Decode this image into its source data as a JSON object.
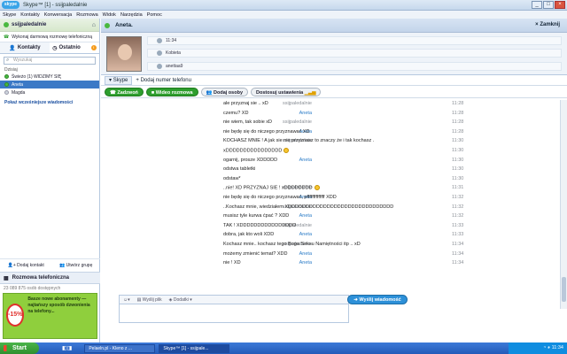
{
  "window": {
    "logo": "skype",
    "title": "Skype™ [1] - ssijpaledalnie"
  },
  "menu": [
    "Skype",
    "Kontakty",
    "Konwersacja",
    "Rozmowa",
    "Widok",
    "Narzędzia",
    "Pomoc"
  ],
  "sidebar": {
    "user": "ssijpaledalnie",
    "free_call": "Wykonaj darmową rozmowę telefoniczną",
    "tabs": [
      "Kontakty",
      "Ostatnio"
    ],
    "search_placeholder": "Wyszukaj",
    "group": "Dzisiaj",
    "contacts": [
      {
        "name": "Świeżo (1) WIDZIMY SIĘ",
        "status": "online"
      },
      {
        "name": "Aneta",
        "status": "online",
        "selected": true
      },
      {
        "name": "Magda",
        "status": "offline"
      }
    ],
    "pending": "Pokaż wcześniejsze wiadomości",
    "add_contact": "Dodaj kontakt",
    "create_group": "Utwórz grupę",
    "phone_call": "Rozmowa telefoniczna",
    "online_count": "23 089 875 osób dostępnych",
    "ad": {
      "badge": "-15%",
      "text": "Basze nowe abonamenty — najtańszy sposób dzwonienia na telefony..."
    }
  },
  "chat": {
    "contact": "Aneta.",
    "close": "Zamknij",
    "profile": {
      "time": "11:34",
      "gender": "Kobieta",
      "login": "anettaa9"
    },
    "tab": "Skype",
    "add_number": "Dodaj numer telefonu",
    "buttons": {
      "call": "Zadzwoń",
      "video": "Wideo rozmowa",
      "add_people": "Dodaj osoby",
      "settings": "Dostosuj ustawienia"
    },
    "messages": [
      {
        "who": "ssijpaledalnie",
        "text": "ale przyznaj sie .. xD",
        "time": "11:28"
      },
      {
        "who": "Aneta",
        "text": "czemu? XD",
        "time": "11:28"
      },
      {
        "who": "ssijpaledalnie",
        "text": "nie wiem, tak sobie xD",
        "time": "11:28"
      },
      {
        "who": "Aneta",
        "text": "nie będę się do niczego przyznawać XD",
        "time": "11:28"
      },
      {
        "who": "ssijpaledalnie",
        "text": "KOCHASZ MNIE ! A jak sie nie przyznasz to znaczy że i tak kochasz .",
        "time": "11:30"
      },
      {
        "who": "",
        "text": "xDDDDDDDDDDDDDDDD",
        "time": "11:30",
        "emoji": true
      },
      {
        "who": "Aneta",
        "text": "ogarnij, prosze XDDDDD",
        "time": "11:30"
      },
      {
        "who": "",
        "text": "odstwa tabletki",
        "time": "11:30"
      },
      {
        "who": "",
        "text": "odstaw*",
        "time": "11:30"
      },
      {
        "who": "ssijpaledalnie",
        "text": "..nie! XD PRZYZNAJ SIE ! xDDDDDDDD",
        "time": "11:31",
        "emoji": true
      },
      {
        "who": "Aneta",
        "text": "nie będę się do niczego przyznawać, pffffffffffffff XDD",
        "time": "11:32"
      },
      {
        "who": "ssijpaledalnie",
        "text": "..Kochasz mnie, wiedziałem XDDDDDDDDDDDDDDDDDDDDDDDDDDDDDD",
        "time": "11:32"
      },
      {
        "who": "Aneta",
        "text": "musisz tyle kurwa ćpać ? XDD",
        "time": "11:32"
      },
      {
        "who": "ssijpaledalnie",
        "text": "TAK ! XDDDDDDDDDDDDDDDD",
        "time": "11:33"
      },
      {
        "who": "Aneta",
        "text": "dobra, jak kto woli XDD",
        "time": "11:33"
      },
      {
        "who": "ssijpaledalnie",
        "text": "Kochasz mnie.. kochasz tego Boga Seksu Namiętności itp .. xD",
        "time": "11:34"
      },
      {
        "who": "Aneta",
        "text": "możemy zmienić temat? XDD",
        "time": "11:34"
      },
      {
        "who": "Aneta",
        "text": "nie ! XD",
        "time": "11:34"
      }
    ],
    "input": {
      "send_file": "Wyślij plik",
      "extras": "Dodatki",
      "send": "Wyślij wiadomość"
    }
  },
  "taskbar": {
    "start": "Start",
    "items": [
      "Pelaeln.pl - Kleno z ...",
      "Skype™ [1] - ssijpale..."
    ],
    "clock": "11:34"
  }
}
